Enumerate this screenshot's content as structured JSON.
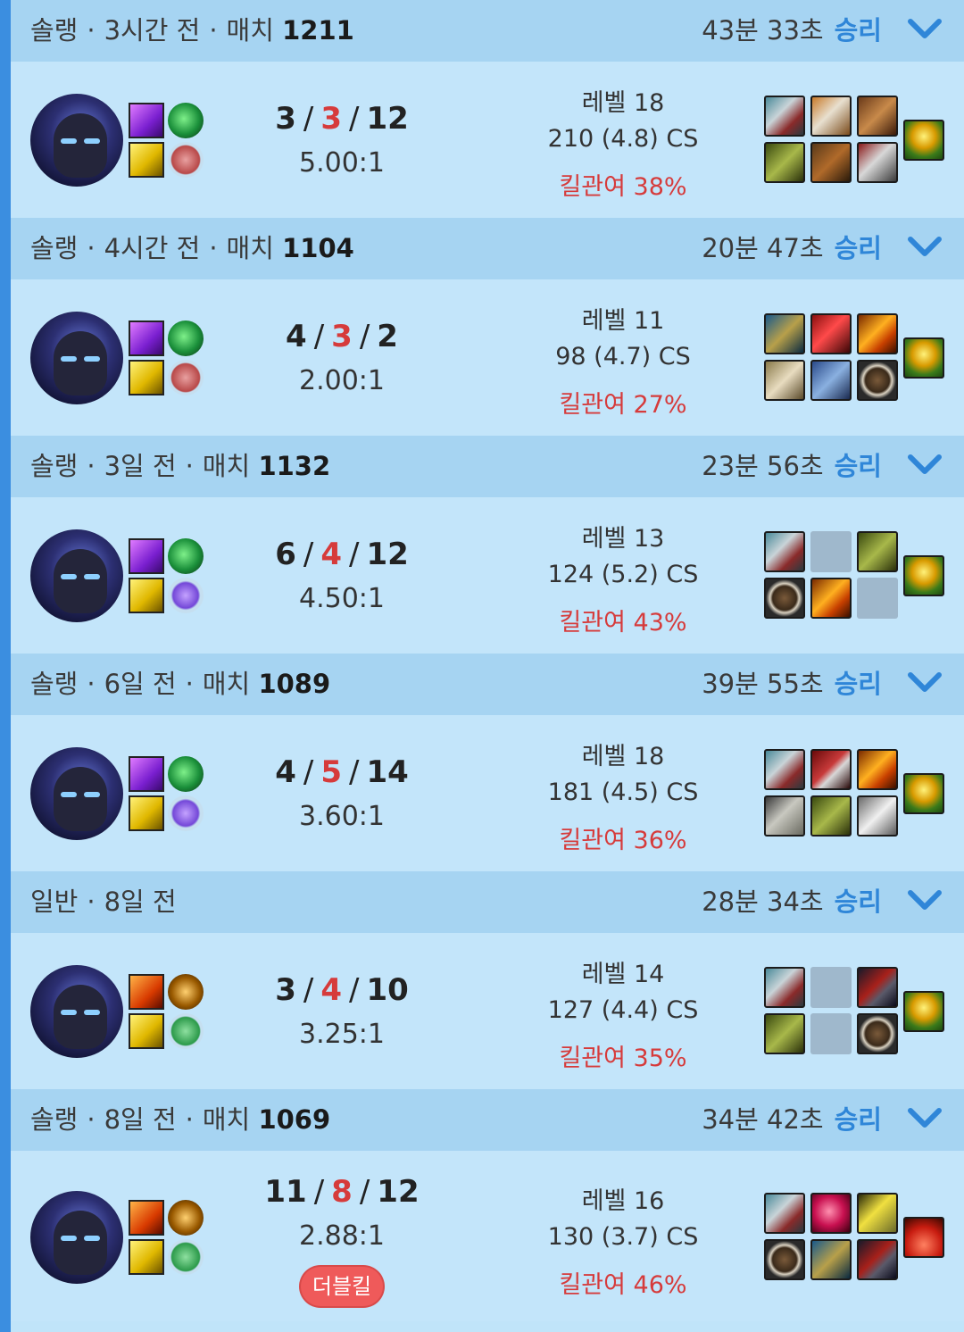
{
  "matches": [
    {
      "header": {
        "mode": "솔랭",
        "ago": "3시간 전",
        "match_label": "매치",
        "match_no": "1211",
        "duration": "43분 33초",
        "result": "승리"
      },
      "kda": {
        "k": "3",
        "d": "3",
        "a": "12",
        "ratio": "5.00:1"
      },
      "stats": {
        "level": "레벨 18",
        "cs": "210 (4.8) CS",
        "kp": "킬관여 38%"
      },
      "spells": [
        "teleport-spell-icon",
        "flash-spell-icon"
      ],
      "runes": [
        "sorcery-rune-icon",
        "conqueror-rune-icon"
      ],
      "items": [
        "item-blade",
        "item-helm",
        "item-armor",
        "item-boots",
        "item-vest",
        "item-gauntlet"
      ],
      "trinket": "oracle-lens-icon",
      "badge": ""
    },
    {
      "header": {
        "mode": "솔랭",
        "ago": "4시간 전",
        "match_label": "매치",
        "match_no": "1104",
        "duration": "20분 47초",
        "result": "승리"
      },
      "kda": {
        "k": "4",
        "d": "3",
        "a": "2",
        "ratio": "2.00:1"
      },
      "stats": {
        "level": "레벨 11",
        "cs": "98 (4.7) CS",
        "kp": "킬관여 27%"
      },
      "spells": [
        "teleport-spell-icon",
        "flash-spell-icon"
      ],
      "runes": [
        "sorcery-rune-icon",
        "conqueror-rune-icon"
      ],
      "items": [
        "item-boots-blue",
        "item-potion",
        "item-sunfire",
        "item-cloak",
        "item-chainmail",
        "item-shield"
      ],
      "trinket": "oracle-lens-icon",
      "badge": ""
    },
    {
      "header": {
        "mode": "솔랭",
        "ago": "3일 전",
        "match_label": "매치",
        "match_no": "1132",
        "duration": "23분 56초",
        "result": "승리"
      },
      "kda": {
        "k": "6",
        "d": "4",
        "a": "12",
        "ratio": "4.50:1"
      },
      "stats": {
        "level": "레벨 13",
        "cs": "124 (5.2) CS",
        "kp": "킬관여 43%"
      },
      "spells": [
        "teleport-spell-icon",
        "flash-spell-icon"
      ],
      "runes": [
        "sorcery-rune-icon",
        "arcane-comet-rune-icon"
      ],
      "items": [
        "item-blade",
        "",
        "item-boots",
        "item-shield",
        "item-sunfire",
        ""
      ],
      "trinket": "oracle-lens-icon",
      "badge": ""
    },
    {
      "header": {
        "mode": "솔랭",
        "ago": "6일 전",
        "match_label": "매치",
        "match_no": "1089",
        "duration": "39분 55초",
        "result": "승리"
      },
      "kda": {
        "k": "4",
        "d": "5",
        "a": "14",
        "ratio": "3.60:1"
      },
      "stats": {
        "level": "레벨 18",
        "cs": "181 (4.5) CS",
        "kp": "킬관여 36%"
      },
      "spells": [
        "teleport-spell-icon",
        "flash-spell-icon"
      ],
      "runes": [
        "sorcery-rune-icon",
        "arcane-comet-rune-icon"
      ],
      "items": [
        "item-blade",
        "item-armor-red",
        "item-sunfire",
        "item-belt",
        "item-boots",
        "item-plate"
      ],
      "trinket": "oracle-lens-icon",
      "badge": ""
    },
    {
      "header": {
        "mode": "일반",
        "ago": "8일 전",
        "match_label": "",
        "match_no": "",
        "duration": "28분 34초",
        "result": "승리"
      },
      "kda": {
        "k": "3",
        "d": "4",
        "a": "10",
        "ratio": "3.25:1"
      },
      "stats": {
        "level": "레벨 14",
        "cs": "127 (4.4) CS",
        "kp": "킬관여 35%"
      },
      "spells": [
        "ignite-spell-icon",
        "flash-spell-icon"
      ],
      "runes": [
        "domination-rune-icon",
        "resolve-rune-icon"
      ],
      "items": [
        "item-blade",
        "",
        "item-dagger",
        "item-boots",
        "",
        "item-shield"
      ],
      "trinket": "oracle-lens-icon",
      "badge": ""
    },
    {
      "header": {
        "mode": "솔랭",
        "ago": "8일 전",
        "match_label": "매치",
        "match_no": "1069",
        "duration": "34분 42초",
        "result": "승리"
      },
      "kda": {
        "k": "11",
        "d": "8",
        "a": "12",
        "ratio": "2.88:1"
      },
      "stats": {
        "level": "레벨 16",
        "cs": "130 (3.7) CS",
        "kp": "킬관여 46%"
      },
      "spells": [
        "ignite-spell-icon",
        "flash-spell-icon"
      ],
      "runes": [
        "domination-rune-icon",
        "resolve-rune-icon"
      ],
      "items": [
        "item-blade",
        "item-orb",
        "item-angel",
        "item-shield",
        "item-boots-blue",
        "item-dagger"
      ],
      "trinket": "scanner-icon",
      "badge": "더블킬"
    }
  ],
  "colors": {
    "result": "#2f86d8",
    "deaths": "#d63b3b",
    "header_bg": "#a6d4f2",
    "body_bg": "#c3e5fa"
  }
}
